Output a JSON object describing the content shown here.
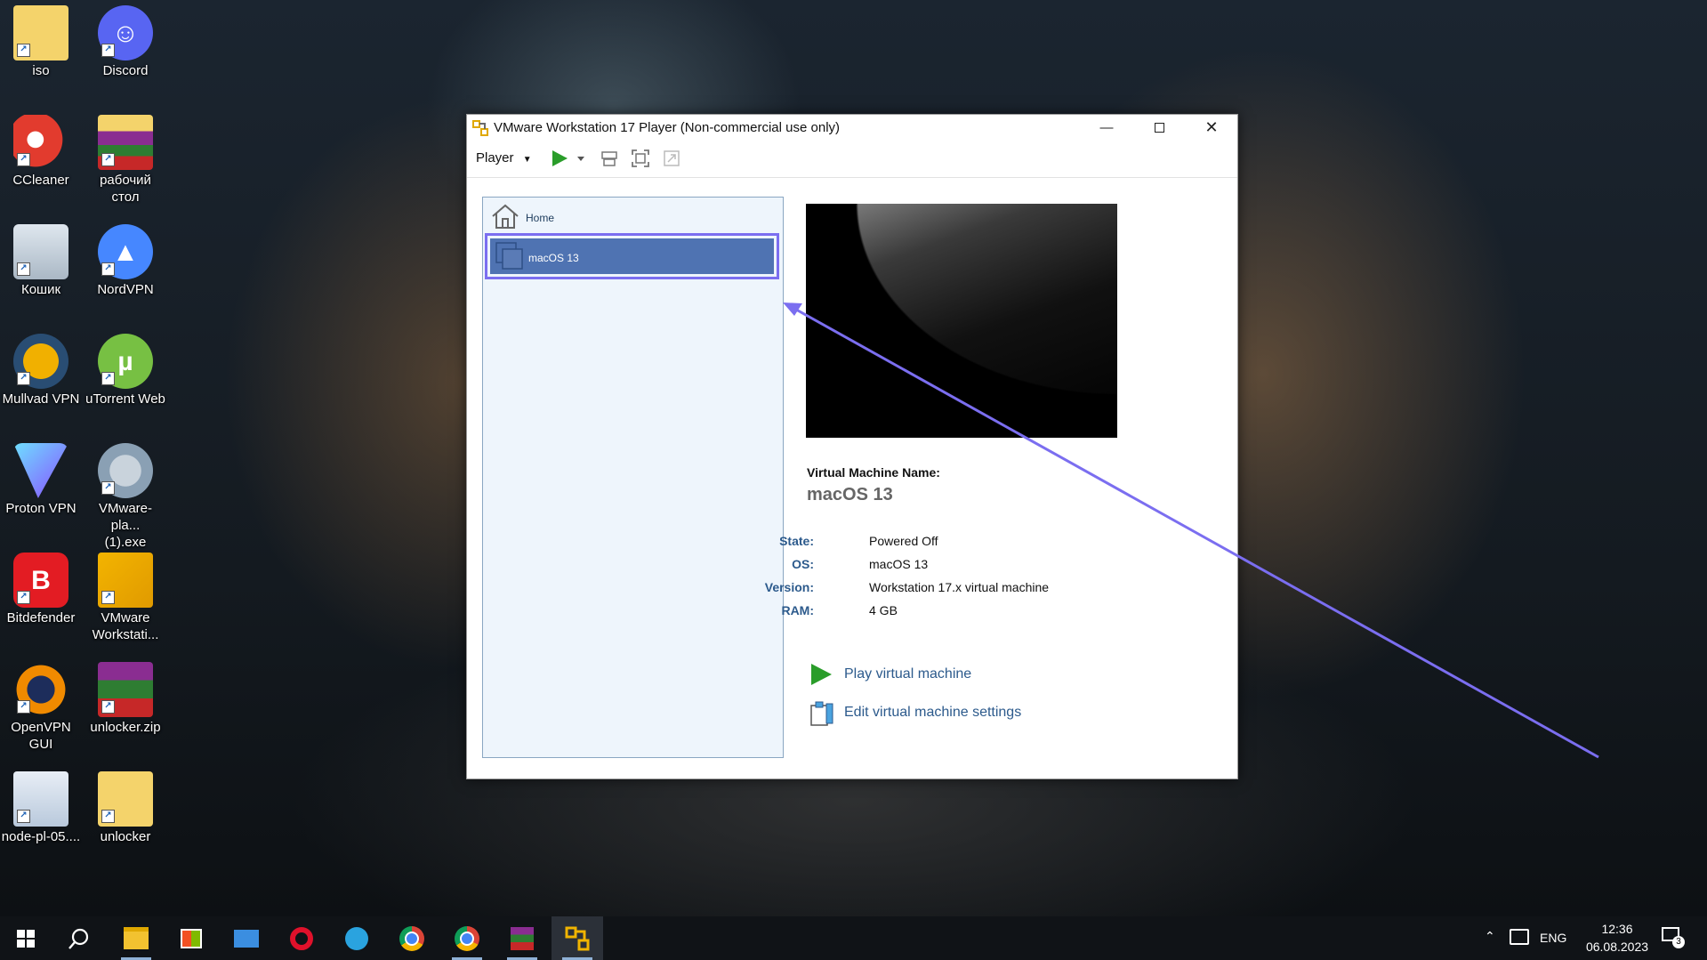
{
  "desktop": {
    "icons": [
      {
        "label": "iso",
        "icon": "folder-icon"
      },
      {
        "label": "Discord",
        "icon": "discord-icon"
      },
      {
        "label": "CCleaner",
        "icon": "ccleaner-icon"
      },
      {
        "label": "рабочий\nстол",
        "icon": "archive-icon"
      },
      {
        "label": "Кошик",
        "icon": "recycle-bin-icon"
      },
      {
        "label": "NordVPN",
        "icon": "nordvpn-icon"
      },
      {
        "label": "Mullvad VPN",
        "icon": "mullvad-icon"
      },
      {
        "label": "uTorrent Web",
        "icon": "utorrent-icon"
      },
      {
        "label": "Proton VPN",
        "icon": "protonvpn-icon"
      },
      {
        "label": "VMware-pla...\n(1).exe",
        "icon": "installer-icon"
      },
      {
        "label": "Bitdefender",
        "icon": "bitdefender-icon"
      },
      {
        "label": "VMware\nWorkstati...",
        "icon": "vmware-icon"
      },
      {
        "label": "OpenVPN\nGUI",
        "icon": "openvpn-icon"
      },
      {
        "label": "unlocker.zip",
        "icon": "winrar-icon"
      },
      {
        "label": "node-pl-05....",
        "icon": "openvpn-config-icon"
      },
      {
        "label": "unlocker",
        "icon": "folder-icon"
      }
    ]
  },
  "window": {
    "title": "VMware Workstation 17 Player (Non-commercial use only)",
    "toolbar": {
      "player_menu": "Player"
    },
    "library": {
      "home_label": "Home",
      "vm_label": "macOS 13"
    },
    "details": {
      "name_heading": "Virtual Machine Name:",
      "name": "macOS 13",
      "state_key": "State:",
      "state_val": "Powered Off",
      "os_key": "OS:",
      "os_val": "macOS 13",
      "version_key": "Version:",
      "version_val": "Workstation 17.x virtual machine",
      "ram_key": "RAM:",
      "ram_val": "4 GB"
    },
    "actions": {
      "play": "Play virtual machine",
      "edit": "Edit virtual machine settings"
    }
  },
  "taskbar": {
    "language": "ENG",
    "time": "12:36",
    "date": "06.08.2023",
    "notification_count": "3"
  },
  "colors": {
    "selection": "#4f73b2",
    "highlight_annotation": "#7b6ef0",
    "link": "#2c5a8c"
  }
}
